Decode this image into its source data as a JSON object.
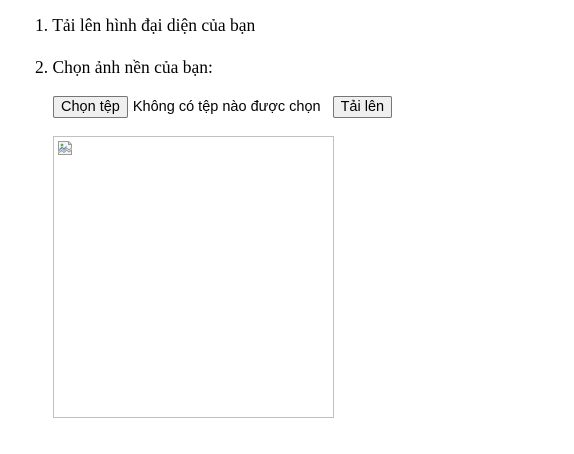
{
  "steps": {
    "step1": {
      "number": "1.",
      "text": "Tải lên hình đại diện của bạn"
    },
    "step2": {
      "number": "2.",
      "text": "Chọn ảnh nền của bạn:"
    }
  },
  "upload": {
    "choose_file_label": "Chọn tệp",
    "no_file_text": "Không có tệp nào được chọn",
    "upload_label": "Tải lên"
  },
  "preview": {
    "icon": "broken-image-icon"
  }
}
